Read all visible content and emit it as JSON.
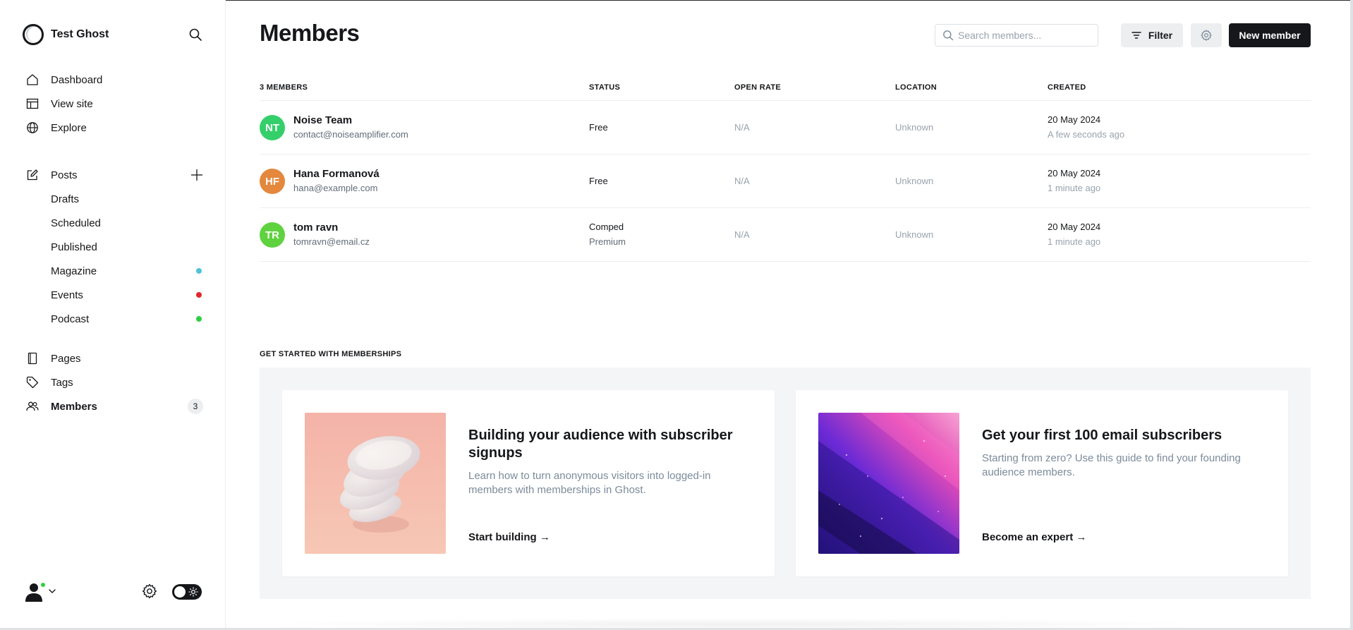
{
  "sidebar": {
    "site_name": "Test Ghost",
    "nav": {
      "dashboard": "Dashboard",
      "view_site": "View site",
      "explore": "Explore",
      "posts": "Posts",
      "pages": "Pages",
      "tags": "Tags",
      "members": "Members"
    },
    "post_items": [
      {
        "label": "Drafts"
      },
      {
        "label": "Scheduled"
      },
      {
        "label": "Published"
      },
      {
        "label": "Magazine",
        "dot_color": "#4fc3d9"
      },
      {
        "label": "Events",
        "dot_color": "#e2262d"
      },
      {
        "label": "Podcast",
        "dot_color": "#30cf43"
      }
    ],
    "members_count": "3"
  },
  "header": {
    "title": "Members",
    "search_placeholder": "Search members...",
    "filter_label": "Filter",
    "new_member_label": "New member"
  },
  "table": {
    "columns": {
      "members": "3 MEMBERS",
      "status": "STATUS",
      "open_rate": "OPEN RATE",
      "location": "LOCATION",
      "created": "CREATED"
    },
    "rows": [
      {
        "initials": "NT",
        "avatar_color": "#34cf6a",
        "name": "Noise Team",
        "email": "contact@noiseamplifier.com",
        "status": "Free",
        "status_sub": "",
        "open_rate": "N/A",
        "location": "Unknown",
        "created": "20 May 2024",
        "created_ago": "A few seconds ago"
      },
      {
        "initials": "HF",
        "avatar_color": "#e3883d",
        "name": "Hana Formanová",
        "email": "hana@example.com",
        "status": "Free",
        "status_sub": "",
        "open_rate": "N/A",
        "location": "Unknown",
        "created": "20 May 2024",
        "created_ago": "1 minute ago"
      },
      {
        "initials": "TR",
        "avatar_color": "#5fd23f",
        "name": "tom ravn",
        "email": "tomravn@email.cz",
        "status": "Comped",
        "status_sub": "Premium",
        "open_rate": "N/A",
        "location": "Unknown",
        "created": "20 May 2024",
        "created_ago": "1 minute ago"
      }
    ]
  },
  "get_started": {
    "label": "GET STARTED WITH MEMBERSHIPS",
    "cards": [
      {
        "title": "Building your audience with subscriber signups",
        "description": "Learn how to turn anonymous visitors into logged-in members with memberships in Ghost.",
        "link": "Start building →"
      },
      {
        "title": "Get your first 100 email subscribers",
        "description": "Starting from zero? Use this guide to find your founding audience members.",
        "link": "Become an expert →"
      }
    ]
  }
}
